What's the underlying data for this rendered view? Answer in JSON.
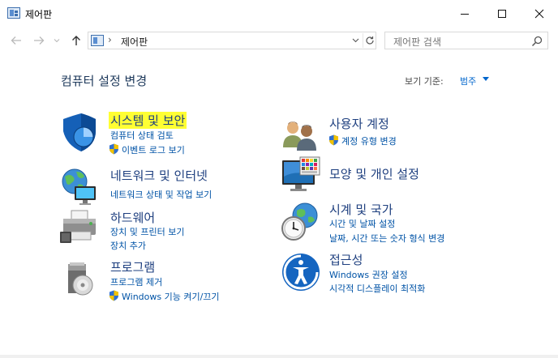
{
  "window": {
    "title": "제어판"
  },
  "address_bar": {
    "path": "제어판",
    "search_placeholder": "제어판 검색"
  },
  "header": {
    "title": "컴퓨터 설정 변경",
    "view_by_label": "보기 기준:",
    "view_by_value": "범주"
  },
  "categories": [
    {
      "title": "시스템 및 보안",
      "highlighted": true,
      "links": [
        {
          "label": "컴퓨터 상태 검토",
          "shield": false
        },
        {
          "label": "이벤트 로그 보기",
          "shield": true
        }
      ]
    },
    {
      "title": "네트워크 및 인터넷",
      "links": [
        {
          "label": "네트워크 상태 및 작업 보기",
          "shield": false
        }
      ]
    },
    {
      "title": "하드웨어",
      "links": [
        {
          "label": "장치 및 프린터 보기",
          "shield": false
        },
        {
          "label": "장치 추가",
          "shield": false
        }
      ]
    },
    {
      "title": "프로그램",
      "links": [
        {
          "label": "프로그램 제거",
          "shield": false
        },
        {
          "label": "Windows 기능 켜기/끄기",
          "shield": true
        }
      ]
    },
    {
      "title": "사용자 계정",
      "links": [
        {
          "label": "계정 유형 변경",
          "shield": true
        }
      ]
    },
    {
      "title": "모양 및 개인 설정",
      "links": []
    },
    {
      "title": "시계 및 국가",
      "links": [
        {
          "label": "시간 및 날짜 설정",
          "shield": false
        },
        {
          "label": "날짜, 시간 또는 숫자 형식 변경",
          "shield": false
        }
      ]
    },
    {
      "title": "접근성",
      "links": [
        {
          "label": "Windows 권장 설정",
          "shield": false
        },
        {
          "label": "시각적 디스플레이 최적화",
          "shield": false
        }
      ]
    }
  ],
  "colors": {
    "highlight": "#ffff33",
    "link": "#0053a6",
    "category_title": "#1e3f7f"
  }
}
